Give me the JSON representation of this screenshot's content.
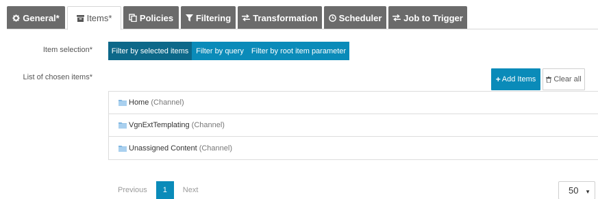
{
  "tabs": [
    {
      "label": "General*",
      "icon": "gear-icon"
    },
    {
      "label": "Items*",
      "icon": "archive-icon"
    },
    {
      "label": "Policies",
      "icon": "copy-icon"
    },
    {
      "label": "Filtering",
      "icon": "filter-icon"
    },
    {
      "label": "Transformation",
      "icon": "exchange-icon"
    },
    {
      "label": "Scheduler",
      "icon": "clock-icon"
    },
    {
      "label": "Job to Trigger",
      "icon": "exchange-icon"
    }
  ],
  "form": {
    "item_selection_label": "Item selection*",
    "chosen_items_label": "List of chosen items*"
  },
  "selection_options": [
    {
      "label": "Filter by selected items",
      "active": true
    },
    {
      "label": "Filter by query",
      "active": false
    },
    {
      "label": "Filter by root item parameter",
      "active": false
    }
  ],
  "actions": {
    "add_items": "Add Items",
    "clear_all": "Clear all"
  },
  "items": [
    {
      "name": "Home",
      "type": "(Channel)"
    },
    {
      "name": "VgnExtTemplating",
      "type": "(Channel)"
    },
    {
      "name": "Unassigned Content",
      "type": "(Channel)"
    }
  ],
  "pagination": {
    "previous": "Previous",
    "current": "1",
    "next": "Next",
    "page_size": "50"
  },
  "colors": {
    "tab_bg": "#6b6b6b",
    "accent": "#0a8bb9",
    "accent_active": "#0d6889"
  }
}
